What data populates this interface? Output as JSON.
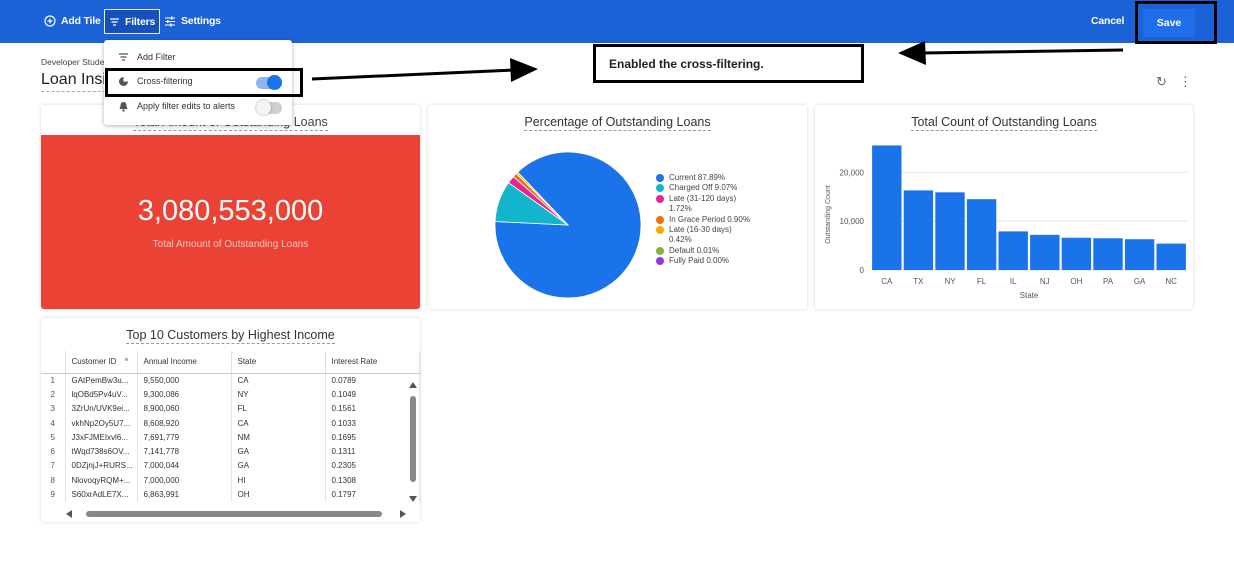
{
  "toolbar": {
    "add_tile": "Add Tile",
    "filters": "Filters",
    "settings": "Settings",
    "cancel": "Cancel",
    "save": "Save"
  },
  "page": {
    "owner": "Developer Studen",
    "title": "Loan Insi"
  },
  "filter_menu": {
    "add_filter": "Add Filter",
    "cross_filtering": "Cross-filtering",
    "cross_filtering_on": true,
    "apply_edits": "Apply filter edits to alerts",
    "apply_edits_on": false
  },
  "annotation": {
    "callout": "Enabled the cross-filtering."
  },
  "tiles": {
    "total": {
      "title": "Total Amount of Outstanding Loans",
      "value": "3,080,553,000",
      "label": "Total Amount of Outstanding Loans",
      "color": "#ea4335"
    },
    "table": {
      "title": "Top 10 Customers by Highest Income",
      "columns": [
        "Customer ID",
        "Annual Income",
        "State",
        "Interest Rate"
      ],
      "sort_indicator": "^",
      "rows": [
        [
          "1",
          "GAtPemBw3u...",
          "9,550,000",
          "CA",
          "0.0789"
        ],
        [
          "2",
          "lqOBd5Pv4uV...",
          "9,300,086",
          "NY",
          "0.1049"
        ],
        [
          "3",
          "3ZrUn/UVK9ei...",
          "8,900,060",
          "FL",
          "0.1561"
        ],
        [
          "4",
          "vkhNp2Oy5U7...",
          "8,608,920",
          "CA",
          "0.1033"
        ],
        [
          "5",
          "J3xFJMEIxvl6...",
          "7,691,779",
          "NM",
          "0.1695"
        ],
        [
          "6",
          "tWqd738s6OV...",
          "7,141,778",
          "GA",
          "0.1311"
        ],
        [
          "7",
          "0DZjnjJ+RURS...",
          "7,000,044",
          "GA",
          "0.2305"
        ],
        [
          "8",
          "NlovoqyRQM+...",
          "7,000,000",
          "HI",
          "0.1308"
        ],
        [
          "9",
          "S60xrAdLE7X...",
          "6,863,991",
          "OH",
          "0.1797"
        ]
      ]
    }
  },
  "chart_data": [
    {
      "type": "pie",
      "title": "Percentage of Outstanding Loans",
      "slices": [
        {
          "label": "Current 87.89%",
          "value": 87.89,
          "color": "#1a73e8"
        },
        {
          "label": "Charged Off 9.07%",
          "value": 9.07,
          "color": "#12b5cb"
        },
        {
          "label": "Late (31-120 days) 1.72%",
          "value": 1.72,
          "color": "#e52592"
        },
        {
          "label": "In Grace Period 0.90%",
          "value": 0.9,
          "color": "#e8710a"
        },
        {
          "label": "Late (16-30 days) 0.42%",
          "value": 0.42,
          "color": "#f9ab00"
        },
        {
          "label": "Default 0.01%",
          "value": 0.01,
          "color": "#7cb342"
        },
        {
          "label": "Fully Paid 0.00%",
          "value": 0.0,
          "color": "#9334e6"
        }
      ],
      "legend_position": "right"
    },
    {
      "type": "bar",
      "title": "Total Count of Outstanding Loans",
      "categories": [
        "CA",
        "TX",
        "NY",
        "FL",
        "IL",
        "NJ",
        "OH",
        "PA",
        "GA",
        "NC"
      ],
      "values": [
        25500,
        16300,
        15900,
        14500,
        7900,
        7200,
        6600,
        6500,
        6300,
        5400
      ],
      "ylim": [
        0,
        26000
      ],
      "yticks": [
        0,
        10000,
        20000
      ],
      "ytick_labels": [
        "0",
        "10,000",
        "20,000"
      ],
      "xlabel": "State",
      "ylabel": "Outstanding Count",
      "color": "#1a73e8",
      "grid": true
    }
  ]
}
